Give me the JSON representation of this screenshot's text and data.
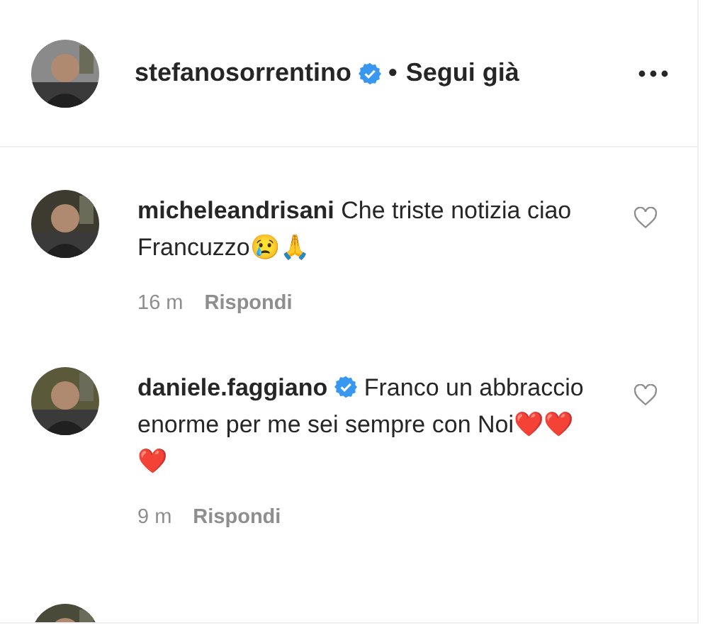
{
  "post_header": {
    "username": "stefanosorrentino",
    "verified": true,
    "separator": "•",
    "follow_status": "Segui già"
  },
  "comments": [
    {
      "username": "micheleandrisani",
      "verified": false,
      "text": "Che triste notizia ciao Francuzzo😢🙏",
      "time": "16 m",
      "reply": "Rispondi",
      "liked": false
    },
    {
      "username": "daniele.faggiano",
      "verified": true,
      "text": "Franco un abbraccio enorme per me sei sempre con Noi❤️❤️❤️",
      "time": "9 m",
      "reply": "Rispondi",
      "liked": false
    }
  ]
}
